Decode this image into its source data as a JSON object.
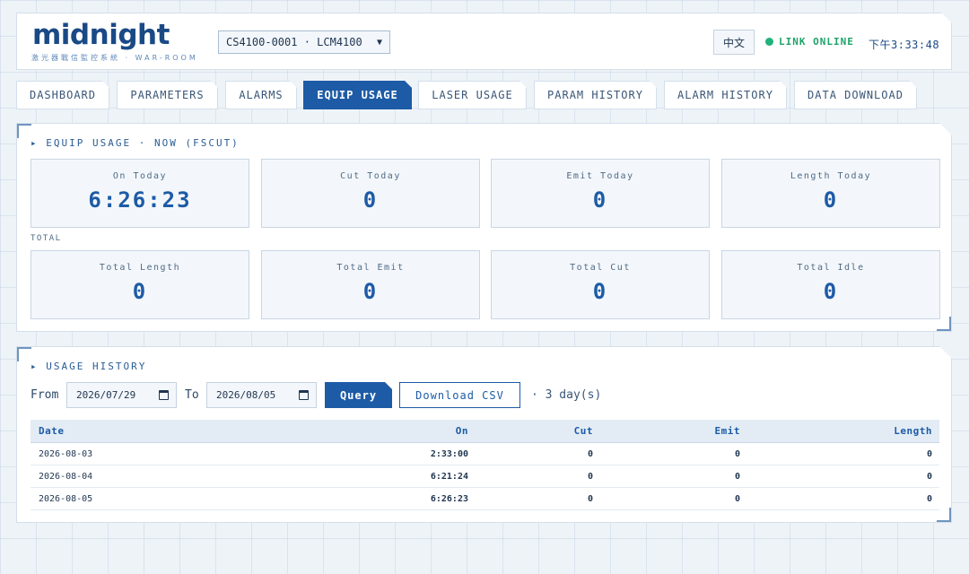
{
  "header": {
    "logo": "midnight",
    "subtitle": "激光器戰信監控系統 · WAR-ROOM",
    "device_selected": "CS4100-0001 · LCM4100",
    "lang_button": "中文",
    "link_status": "LINK ONLINE",
    "clock": "下午3:33:48"
  },
  "tabs": [
    {
      "label": "DASHBOARD"
    },
    {
      "label": "PARAMETERS"
    },
    {
      "label": "ALARMS"
    },
    {
      "label": "EQUIP USAGE",
      "active": true
    },
    {
      "label": "LASER USAGE"
    },
    {
      "label": "PARAM HISTORY"
    },
    {
      "label": "ALARM HISTORY"
    },
    {
      "label": "DATA DOWNLOAD"
    }
  ],
  "usage_now": {
    "title": "▸ EQUIP USAGE · NOW (FSCUT)",
    "today_cards": [
      {
        "label": "On Today",
        "value": "6:26:23"
      },
      {
        "label": "Cut Today",
        "value": "0"
      },
      {
        "label": "Emit Today",
        "value": "0"
      },
      {
        "label": "Length Today",
        "value": "0"
      }
    ],
    "total_label": "TOTAL",
    "total_cards": [
      {
        "label": "Total Length",
        "value": "0"
      },
      {
        "label": "Total Emit",
        "value": "0"
      },
      {
        "label": "Total Cut",
        "value": "0"
      },
      {
        "label": "Total Idle",
        "value": "0"
      }
    ]
  },
  "history": {
    "title": "▸ USAGE HISTORY",
    "from_label": "From",
    "from_date": "2026/07/29",
    "to_label": "To",
    "to_date": "2026/08/05",
    "query_button": "Query",
    "csv_button": "Download CSV",
    "days_text": "· 3 day(s)",
    "columns": [
      "Date",
      "On",
      "Cut",
      "Emit",
      "Length"
    ],
    "rows": [
      [
        "2026-08-03",
        "2:33:00",
        "0",
        "0",
        "0"
      ],
      [
        "2026-08-04",
        "6:21:24",
        "0",
        "0",
        "0"
      ],
      [
        "2026-08-05",
        "6:26:23",
        "0",
        "0",
        "0"
      ]
    ]
  },
  "colors": {
    "accent": "#1d5ba6",
    "online": "#1fb27a",
    "background": "#eef3f8"
  }
}
